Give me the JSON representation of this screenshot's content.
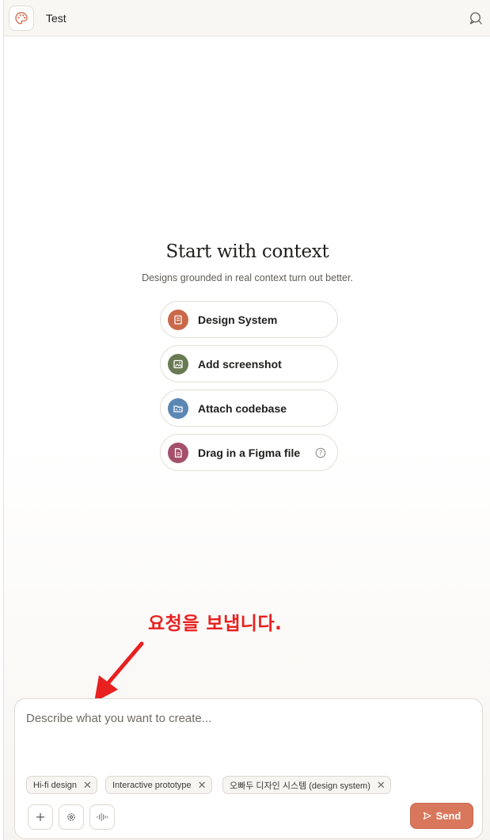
{
  "header": {
    "title": "Test",
    "app_icon": "palette-icon",
    "right_icon": "chat-bubble-icon"
  },
  "main": {
    "heading": "Start with context",
    "subheading": "Designs grounded in real context turn out better.",
    "context_options": [
      {
        "label": "Design System",
        "icon": "book-icon",
        "color": "#c9694a"
      },
      {
        "label": "Add screenshot",
        "icon": "image-icon",
        "color": "#687a52"
      },
      {
        "label": "Attach codebase",
        "icon": "folder-icon",
        "color": "#5b87b5"
      },
      {
        "label": "Drag in a Figma file",
        "icon": "file-icon",
        "color": "#a4506a",
        "help_icon": "question-circle-icon"
      }
    ]
  },
  "annotation": {
    "text": "요청을 보냅니다.",
    "color": "#e8201f"
  },
  "composer": {
    "placeholder": "Describe what you want to create...",
    "value": "",
    "chips": [
      {
        "label": "Hi-fi design"
      },
      {
        "label": "Interactive prototype"
      },
      {
        "label": "오빠두 디자인 시스템 (design system)"
      }
    ],
    "tools": [
      "plus-icon",
      "settings-icon",
      "audio-wave-icon"
    ],
    "send_label": "Send",
    "send_color": "#d9775c"
  }
}
